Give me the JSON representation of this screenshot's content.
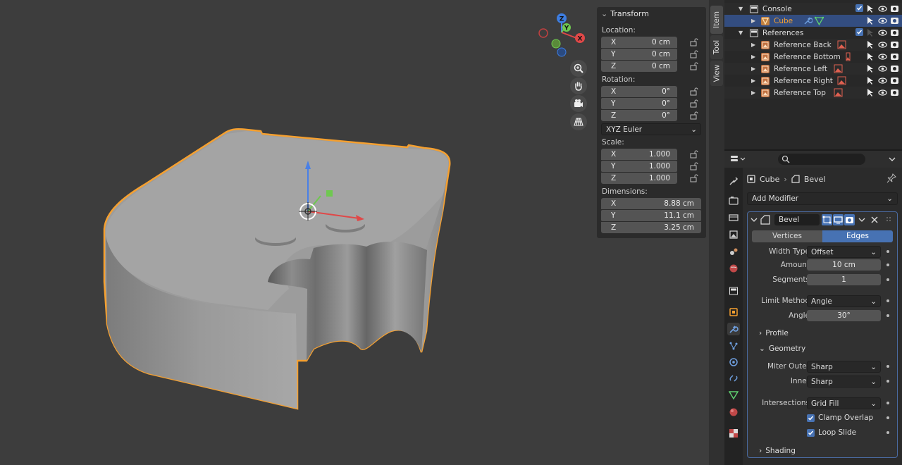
{
  "viewport": {
    "tools": [
      "zoom-icon",
      "pan-hand-icon",
      "camera-icon",
      "grid-view-icon"
    ],
    "gizmo": {
      "z": "Z",
      "y": "Y",
      "x": "X"
    }
  },
  "npanel": {
    "title": "Transform",
    "location_label": "Location:",
    "location": [
      {
        "axis": "X",
        "value": "0 cm"
      },
      {
        "axis": "Y",
        "value": "0 cm"
      },
      {
        "axis": "Z",
        "value": "0 cm"
      }
    ],
    "rotation_label": "Rotation:",
    "rotation": [
      {
        "axis": "X",
        "value": "0°"
      },
      {
        "axis": "Y",
        "value": "0°"
      },
      {
        "axis": "Z",
        "value": "0°"
      }
    ],
    "rotation_mode": "XYZ Euler",
    "scale_label": "Scale:",
    "scale": [
      {
        "axis": "X",
        "value": "1.000"
      },
      {
        "axis": "Y",
        "value": "1.000"
      },
      {
        "axis": "Z",
        "value": "1.000"
      }
    ],
    "dimensions_label": "Dimensions:",
    "dimensions": [
      {
        "axis": "X",
        "value": "8.88 cm"
      },
      {
        "axis": "Y",
        "value": "11.1 cm"
      },
      {
        "axis": "Z",
        "value": "3.25 cm"
      }
    ]
  },
  "vtabs": [
    "Item",
    "Tool",
    "View"
  ],
  "outliner": {
    "rows": [
      {
        "name": "Console",
        "type": "collection"
      },
      {
        "name": "Cube",
        "type": "mesh"
      },
      {
        "name": "References",
        "type": "collection"
      },
      {
        "name": "Reference Back",
        "type": "image"
      },
      {
        "name": "Reference Bottom",
        "type": "image"
      },
      {
        "name": "Reference Left",
        "type": "image"
      },
      {
        "name": "Reference Right",
        "type": "image"
      },
      {
        "name": "Reference Top",
        "type": "image"
      }
    ]
  },
  "properties": {
    "breadcrumb": {
      "object": "Cube",
      "modifier": "Bevel"
    },
    "add_modifier": "Add Modifier",
    "modifier_name": "Bevel",
    "affect_tabs": {
      "vertices": "Vertices",
      "edges": "Edges"
    },
    "width_type_label": "Width Type",
    "width_type": "Offset",
    "amount_label": "Amount",
    "amount": "10 cm",
    "segments_label": "Segments",
    "segments": "1",
    "limit_method_label": "Limit Method",
    "limit_method": "Angle",
    "angle_label": "Angle",
    "angle": "30°",
    "profile_label": "Profile",
    "geometry_label": "Geometry",
    "miter_outer_label": "Miter Outer",
    "miter_outer": "Sharp",
    "inner_label": "Inner",
    "inner": "Sharp",
    "intersections_label": "Intersections",
    "intersections": "Grid Fill",
    "clamp_overlap": "Clamp Overlap",
    "loop_slide": "Loop Slide",
    "shading_label": "Shading"
  },
  "colors": {
    "selection": "#f5a030",
    "accent": "#4772b3",
    "selected_row": "#334d80"
  }
}
